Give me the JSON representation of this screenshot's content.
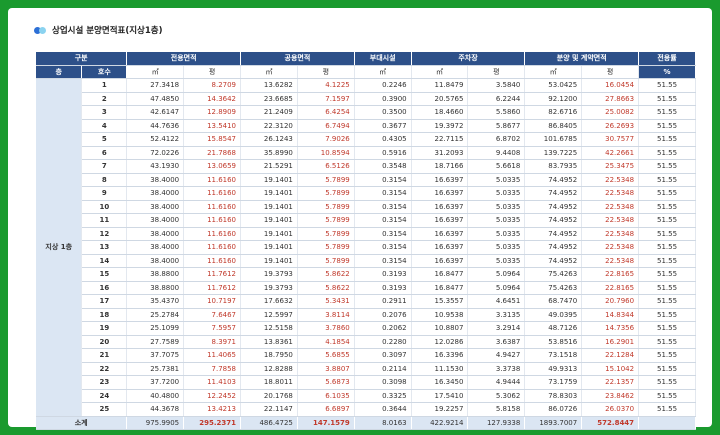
{
  "title": "상업시설 분양면적표(지상1층)",
  "header": {
    "division": "구분",
    "exclusive": "전용면적",
    "common": "공용면적",
    "ancillary": "부대시설",
    "parking": "주차장",
    "sale": "분양 및 계약면적",
    "ratio": "전용률",
    "floor": "층",
    "unit": "호수",
    "sqm": "㎡",
    "pyeong": "평",
    "pct": "%"
  },
  "floor_label": "지상 1층",
  "rows": [
    [
      "1",
      "27.3418",
      "8.2709",
      "13.6282",
      "4.1225",
      "0.2246",
      "11.8479",
      "3.5840",
      "53.0425",
      "16.0454",
      "51.55"
    ],
    [
      "2",
      "47.4850",
      "14.3642",
      "23.6685",
      "7.1597",
      "0.3900",
      "20.5765",
      "6.2244",
      "92.1200",
      "27.8663",
      "51.55"
    ],
    [
      "3",
      "42.6147",
      "12.8909",
      "21.2409",
      "6.4254",
      "0.3500",
      "18.4660",
      "5.5860",
      "82.6716",
      "25.0082",
      "51.55"
    ],
    [
      "4",
      "44.7636",
      "13.5410",
      "22.3120",
      "6.7494",
      "0.3677",
      "19.3972",
      "5.8677",
      "86.8405",
      "26.2693",
      "51.55"
    ],
    [
      "5",
      "52.4122",
      "15.8547",
      "26.1243",
      "7.9026",
      "0.4305",
      "22.7115",
      "6.8702",
      "101.6785",
      "30.7577",
      "51.55"
    ],
    [
      "6",
      "72.0226",
      "21.7868",
      "35.8990",
      "10.8594",
      "0.5916",
      "31.2093",
      "9.4408",
      "139.7225",
      "42.2661",
      "51.55"
    ],
    [
      "7",
      "43.1930",
      "13.0659",
      "21.5291",
      "6.5126",
      "0.3548",
      "18.7166",
      "5.6618",
      "83.7935",
      "25.3475",
      "51.55"
    ],
    [
      "8",
      "38.4000",
      "11.6160",
      "19.1401",
      "5.7899",
      "0.3154",
      "16.6397",
      "5.0335",
      "74.4952",
      "22.5348",
      "51.55"
    ],
    [
      "9",
      "38.4000",
      "11.6160",
      "19.1401",
      "5.7899",
      "0.3154",
      "16.6397",
      "5.0335",
      "74.4952",
      "22.5348",
      "51.55"
    ],
    [
      "10",
      "38.4000",
      "11.6160",
      "19.1401",
      "5.7899",
      "0.3154",
      "16.6397",
      "5.0335",
      "74.4952",
      "22.5348",
      "51.55"
    ],
    [
      "11",
      "38.4000",
      "11.6160",
      "19.1401",
      "5.7899",
      "0.3154",
      "16.6397",
      "5.0335",
      "74.4952",
      "22.5348",
      "51.55"
    ],
    [
      "12",
      "38.4000",
      "11.6160",
      "19.1401",
      "5.7899",
      "0.3154",
      "16.6397",
      "5.0335",
      "74.4952",
      "22.5348",
      "51.55"
    ],
    [
      "13",
      "38.4000",
      "11.6160",
      "19.1401",
      "5.7899",
      "0.3154",
      "16.6397",
      "5.0335",
      "74.4952",
      "22.5348",
      "51.55"
    ],
    [
      "14",
      "38.4000",
      "11.6160",
      "19.1401",
      "5.7899",
      "0.3154",
      "16.6397",
      "5.0335",
      "74.4952",
      "22.5348",
      "51.55"
    ],
    [
      "15",
      "38.8800",
      "11.7612",
      "19.3793",
      "5.8622",
      "0.3193",
      "16.8477",
      "5.0964",
      "75.4263",
      "22.8165",
      "51.55"
    ],
    [
      "16",
      "38.8800",
      "11.7612",
      "19.3793",
      "5.8622",
      "0.3193",
      "16.8477",
      "5.0964",
      "75.4263",
      "22.8165",
      "51.55"
    ],
    [
      "17",
      "35.4370",
      "10.7197",
      "17.6632",
      "5.3431",
      "0.2911",
      "15.3557",
      "4.6451",
      "68.7470",
      "20.7960",
      "51.55"
    ],
    [
      "18",
      "25.2784",
      "7.6467",
      "12.5997",
      "3.8114",
      "0.2076",
      "10.9538",
      "3.3135",
      "49.0395",
      "14.8344",
      "51.55"
    ],
    [
      "19",
      "25.1099",
      "7.5957",
      "12.5158",
      "3.7860",
      "0.2062",
      "10.8807",
      "3.2914",
      "48.7126",
      "14.7356",
      "51.55"
    ],
    [
      "20",
      "27.7589",
      "8.3971",
      "13.8361",
      "4.1854",
      "0.2280",
      "12.0286",
      "3.6387",
      "53.8516",
      "16.2901",
      "51.55"
    ],
    [
      "21",
      "37.7075",
      "11.4065",
      "18.7950",
      "5.6855",
      "0.3097",
      "16.3396",
      "4.9427",
      "73.1518",
      "22.1284",
      "51.55"
    ],
    [
      "22",
      "25.7381",
      "7.7858",
      "12.8288",
      "3.8807",
      "0.2114",
      "11.1530",
      "3.3738",
      "49.9313",
      "15.1042",
      "51.55"
    ],
    [
      "23",
      "37.7200",
      "11.4103",
      "18.8011",
      "5.6873",
      "0.3098",
      "16.3450",
      "4.9444",
      "73.1759",
      "22.1357",
      "51.55"
    ],
    [
      "24",
      "40.4800",
      "12.2452",
      "20.1768",
      "6.1035",
      "0.3325",
      "17.5410",
      "5.3062",
      "78.8303",
      "23.8462",
      "51.55"
    ],
    [
      "25",
      "44.3678",
      "13.4213",
      "22.1147",
      "6.6897",
      "0.3644",
      "19.2257",
      "5.8158",
      "86.0726",
      "26.0370",
      "51.55"
    ]
  ],
  "total": {
    "label": "소계",
    "values": [
      "975.9905",
      "295.2371",
      "486.4725",
      "147.1579",
      "8.0163",
      "422.9214",
      "127.9338",
      "1893.7007",
      "572.8447",
      ""
    ]
  },
  "colors": {
    "frame": "#1a9a2e",
    "header_bg": "#2d5089",
    "accent_red": "#c0392b",
    "floor_bg": "#dbe6f3"
  }
}
